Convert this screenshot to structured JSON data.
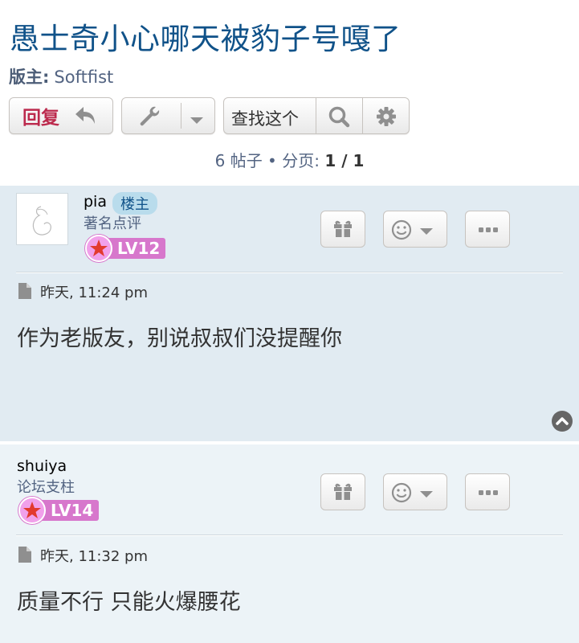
{
  "topic": {
    "title": "愚士奇小心哪天被豹子号嘎了"
  },
  "moderator": {
    "label": "版主:",
    "name": "Softfist"
  },
  "toolbar": {
    "reply_label": "回复",
    "search_placeholder": "查找这个"
  },
  "pagination": {
    "prefix": "6 帖子 • 分页: ",
    "current": "1",
    "sep": " / ",
    "total": "1"
  },
  "posts": [
    {
      "username": "pia",
      "author_badge": "楼主",
      "rank": "著名点评",
      "level": "LV12",
      "time": "昨天, 11:24 pm",
      "content": "作为老版友，别说叔叔们没提醒你"
    },
    {
      "username": "shuiya",
      "rank": "论坛支柱",
      "level": "LV14",
      "time": "昨天, 11:32 pm",
      "content": "质量不行 只能火爆腰花"
    }
  ],
  "colors": {
    "title": "#105289",
    "reply": "#bc2a4d",
    "post1_bg": "#e1ebf2",
    "post2_bg": "#ecf3f7",
    "level_badge": "#d777cc",
    "author_badge": "#b9dcec"
  },
  "icons": [
    "reply-arrow-icon",
    "wrench-icon",
    "chevron-down-icon",
    "search-icon",
    "gear-icon",
    "gift-icon",
    "smiley-icon",
    "more-icon",
    "document-icon",
    "star-icon",
    "back-to-top-icon"
  ]
}
